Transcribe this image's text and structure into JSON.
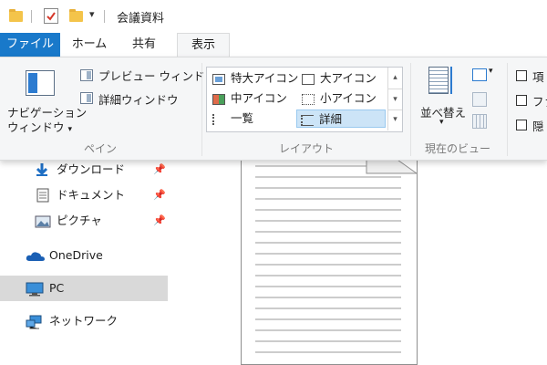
{
  "window": {
    "title": "会議資料"
  },
  "quick_access": {
    "dropdown_glyph": "▾"
  },
  "tabs": [
    {
      "label": "ファイル"
    },
    {
      "label": "ホーム"
    },
    {
      "label": "共有"
    },
    {
      "label": "表示"
    }
  ],
  "ribbon": {
    "pane_group": {
      "nav_pane_label_line1": "ナビゲーション",
      "nav_pane_label_line2": "ウィンドウ",
      "preview_pane": "プレビュー ウィンドウ",
      "details_pane": "詳細ウィンドウ",
      "group_label": "ペイン"
    },
    "layout_group": {
      "items": [
        "特大アイコン",
        "大アイコン",
        "中アイコン",
        "小アイコン",
        "一覧",
        "詳細"
      ],
      "selected": "詳細",
      "group_label": "レイアウト"
    },
    "current_view_group": {
      "sort_label": "並べ替え",
      "group_label": "現在のビュー"
    },
    "show_hide_group": {
      "checkbox_labels_partial": [
        "項",
        "ファ",
        "隠"
      ]
    }
  },
  "nav_pane": {
    "items": [
      {
        "label": "ダウンロード",
        "icon": "download-arrow-icon",
        "pinned": true
      },
      {
        "label": "ドキュメント",
        "icon": "document-icon",
        "pinned": true
      },
      {
        "label": "ピクチャ",
        "icon": "picture-icon",
        "pinned": true
      },
      {
        "label": "OneDrive",
        "icon": "onedrive-cloud-icon",
        "pinned": false
      },
      {
        "label": "PC",
        "icon": "pc-monitor-icon",
        "pinned": false,
        "selected": true
      },
      {
        "label": "ネットワーク",
        "icon": "network-icon",
        "pinned": false
      }
    ],
    "pin_glyph": "📌"
  },
  "colors": {
    "file_tab": "#1979ca",
    "ribbon_bg": "#f5f6f7",
    "selected_layout": "#cce4f7",
    "nav_selected": "#d9d9d9",
    "onedrive_blue": "#1a5fb4"
  }
}
